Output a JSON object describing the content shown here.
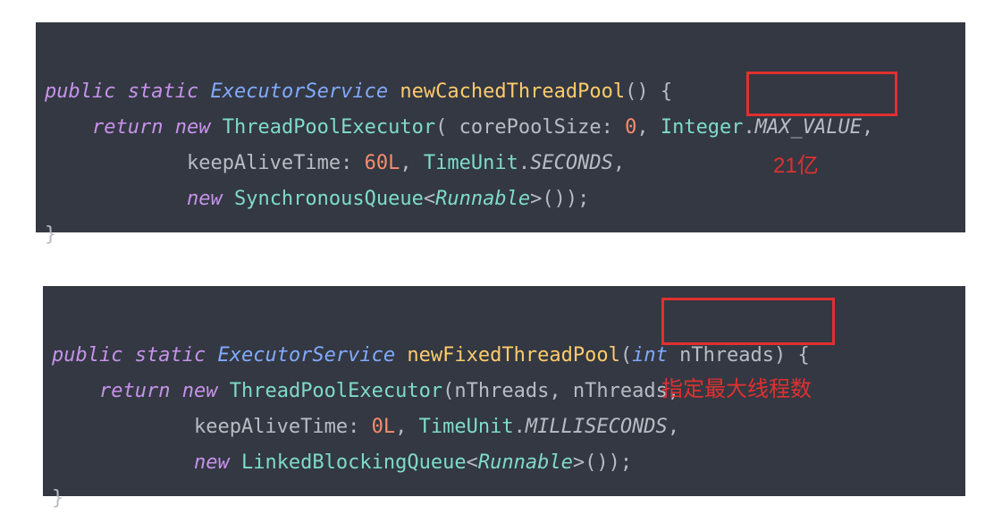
{
  "block1": {
    "line1": {
      "kw1": "public",
      "kw2": "static",
      "type": "ExecutorService",
      "method": "newCachedThreadPool",
      "tail": "() {"
    },
    "line2": {
      "ret": "return",
      "new": "new",
      "cls": "ThreadPoolExecutor",
      "open": "(",
      "p1label": " corePoolSize:",
      "p1val": " 0",
      "comma1": ", ",
      "p2a": "Integer",
      "dot": ".",
      "p2b": "MAX_VALUE",
      "comma2": ","
    },
    "line3": {
      "p3label": "keepAliveTime:",
      "p3val": " 60L",
      "comma1": ", ",
      "tu": "TimeUnit",
      "dot": ".",
      "unit": "SECONDS",
      "comma2": ","
    },
    "line4": {
      "new": "new",
      "cls": "SynchronousQueue",
      "lt": "<",
      "gen": "Runnable",
      "gt": ">",
      "tail": "());"
    },
    "line5": {
      "brace": "}"
    }
  },
  "block2": {
    "line1": {
      "kw1": "public",
      "kw2": "static",
      "type": "ExecutorService",
      "method": "newFixedThreadPool",
      "open": "(",
      "ptype": "int",
      "pname": " nThreads",
      "tail": ") {"
    },
    "line2": {
      "ret": "return",
      "new": "new",
      "cls": "ThreadPoolExecutor",
      "open": "(",
      "a1": "nThreads",
      "c1": ", ",
      "a2": "nThreads",
      "c2": ","
    },
    "line3": {
      "p3label": "keepAliveTime:",
      "p3val": " 0L",
      "comma1": ", ",
      "tu": "TimeUnit",
      "dot": ".",
      "unit": "MILLISECONDS",
      "comma2": ","
    },
    "line4": {
      "new": "new",
      "cls": "LinkedBlockingQueue",
      "lt": "<",
      "gen": "Runnable",
      "gt": ">",
      "tail": "());"
    },
    "line5": {
      "brace": "}"
    }
  },
  "annot": {
    "a1": "21亿",
    "a2": "指定最大线程数"
  }
}
